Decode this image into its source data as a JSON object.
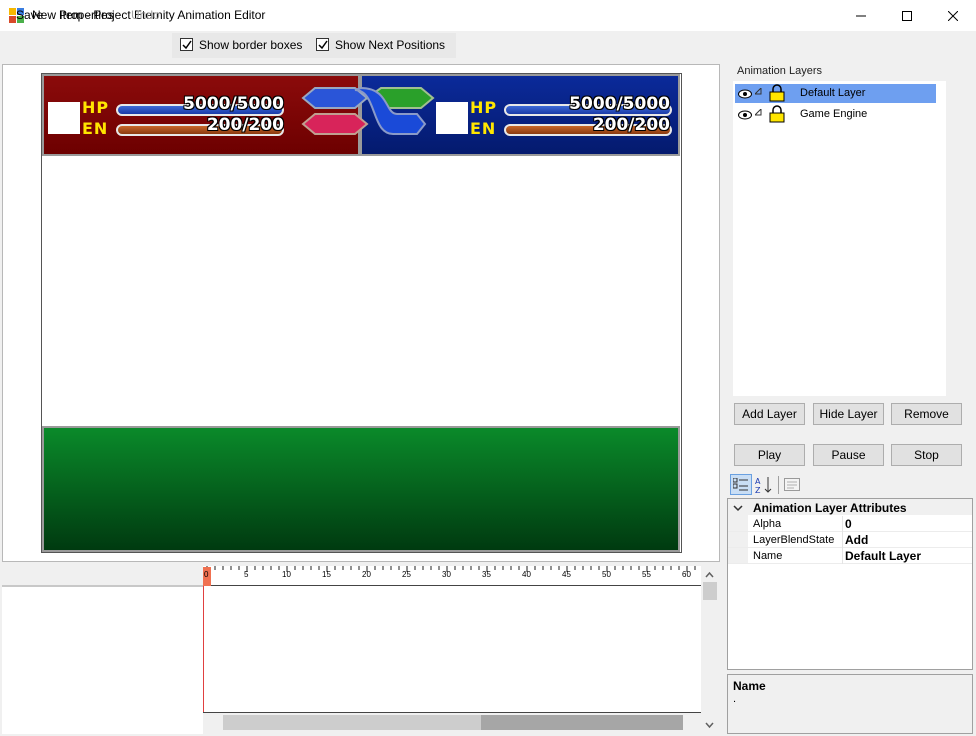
{
  "window": {
    "title": "New Item - Project Eternity Animation Editor",
    "controls": {
      "minimize": "—",
      "maximize": "☐",
      "close": "✕"
    }
  },
  "menu": {
    "save": "Save",
    "properties": "Properties",
    "undo": "Undo",
    "show_border_boxes": "Show border boxes",
    "show_next_positions": "Show Next Positions",
    "show_border_boxes_checked": true,
    "show_next_positions_checked": true
  },
  "hud": {
    "left": {
      "hp_label": "HP",
      "en_label": "EN",
      "hp_value": "5000/5000",
      "en_value": "200/200",
      "color": "#7a0000"
    },
    "right": {
      "hp_label": "HP",
      "en_label": "EN",
      "hp_value": "5000/5000",
      "en_value": "200/200",
      "color": "#06208a"
    },
    "bottom_color": "#0a6a20"
  },
  "timeline": {
    "ruler_labels": [
      "0",
      "5",
      "10",
      "15",
      "20",
      "25",
      "30",
      "35",
      "40",
      "45",
      "50",
      "55",
      "60"
    ]
  },
  "layers": {
    "group_title": "Animation Layers",
    "items": [
      {
        "name": "Default Layer",
        "selected": true
      },
      {
        "name": "Game Engine",
        "selected": false
      }
    ],
    "add_label": "Add Layer",
    "hide_label": "Hide Layer",
    "remove_label": "Remove",
    "play_label": "Play",
    "pause_label": "Pause",
    "stop_label": "Stop"
  },
  "property_grid": {
    "category": "Animation Layer Attributes",
    "rows": [
      {
        "name": "Alpha",
        "value": "0"
      },
      {
        "name": "LayerBlendState",
        "value": "Add"
      },
      {
        "name": "Name",
        "value": "Default Layer"
      }
    ],
    "description_title": "Name",
    "description_text": "."
  },
  "colors": {
    "selection": "#6e9ff0",
    "accent_red": "#e04040"
  }
}
